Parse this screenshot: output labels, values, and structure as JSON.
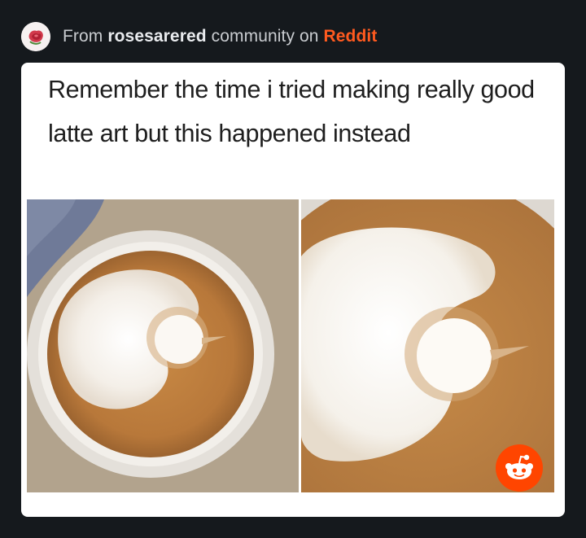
{
  "header": {
    "prefix": "From",
    "community": "rosesarered",
    "middle": "community on",
    "platform": "Reddit",
    "avatar_icon": "rose-avatar-icon"
  },
  "post": {
    "caption": "Remember the time i tried making really good latte art but this happened instead",
    "images": [
      {
        "name": "latte-photo-zoomed-out",
        "icon": "latte-cup-image"
      },
      {
        "name": "latte-photo-close-up",
        "icon": "latte-foam-image"
      }
    ]
  },
  "badge": {
    "icon": "reddit-alien-icon",
    "color": "#ff4500"
  },
  "colors": {
    "background": "#15191d",
    "card": "#ffffff",
    "accent": "#ff5a1f"
  }
}
